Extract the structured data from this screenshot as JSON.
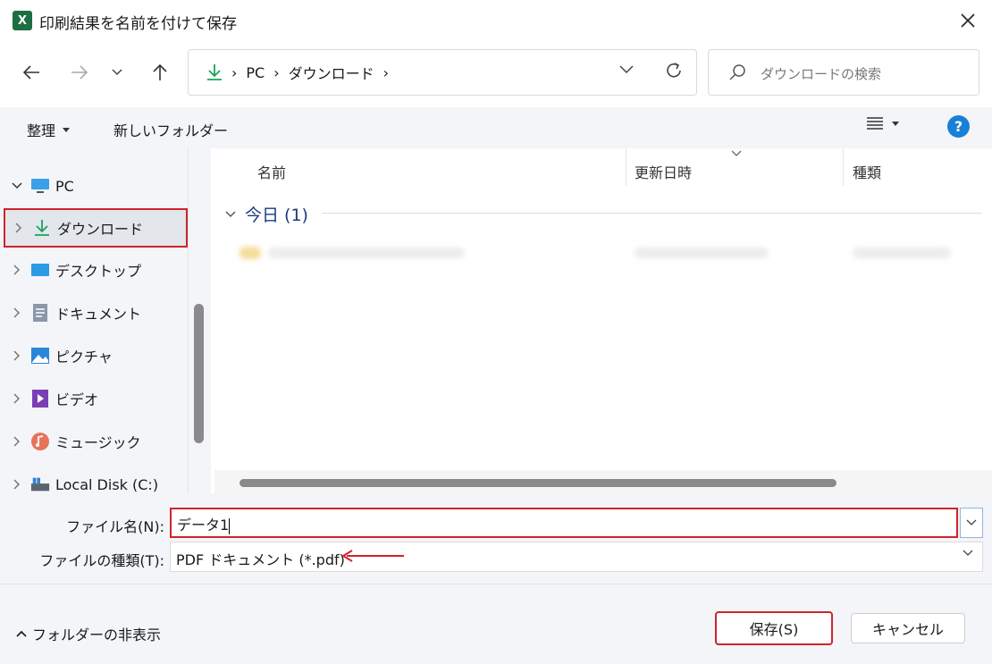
{
  "window": {
    "title": "印刷結果を名前を付けて保存",
    "app_icon_letter": "X"
  },
  "address": {
    "root": "PC",
    "folder": "ダウンロード"
  },
  "search": {
    "placeholder": "ダウンロードの検索"
  },
  "toolbar": {
    "organize": "整理",
    "new_folder": "新しいフォルダー",
    "help": "?"
  },
  "sidebar": {
    "root": "PC",
    "items": [
      {
        "label": "ダウンロード",
        "icon": "download-icon",
        "selected": true
      },
      {
        "label": "デスクトップ",
        "icon": "desktop-icon"
      },
      {
        "label": "ドキュメント",
        "icon": "document-icon"
      },
      {
        "label": "ピクチャ",
        "icon": "pictures-icon"
      },
      {
        "label": "ビデオ",
        "icon": "video-icon"
      },
      {
        "label": "ミュージック",
        "icon": "music-icon"
      },
      {
        "label": "Local Disk (C:)",
        "icon": "disk-icon"
      }
    ]
  },
  "filelist": {
    "columns": [
      "名前",
      "更新日時",
      "種類"
    ],
    "group": "今日 (1)"
  },
  "form": {
    "filename_label": "ファイル名(N):",
    "filename_value": "データ1",
    "filetype_label": "ファイルの種類(T):",
    "filetype_value": "PDF ドキュメント (*.pdf)"
  },
  "footer": {
    "hide_folders": "フォルダーの非表示",
    "save": "保存(S)",
    "cancel": "キャンセル"
  },
  "colors": {
    "accent": "#1a7fd6",
    "highlight": "#d0232a",
    "excel": "#1d6f42"
  }
}
